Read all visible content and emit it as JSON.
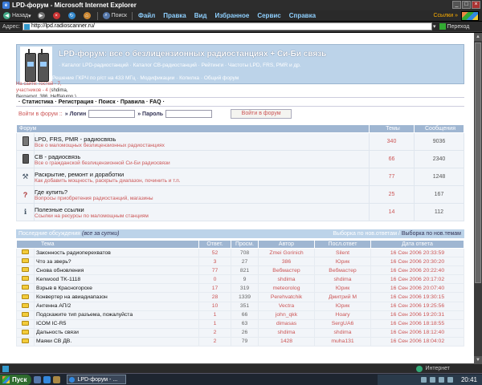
{
  "window": {
    "title": "LPD-форум - Microsoft Internet Explorer"
  },
  "toolbar": {
    "back_label": "Назад",
    "search_label": "Поиск",
    "menu": [
      "Файл",
      "Правка",
      "Вид",
      "Избранное",
      "Сервис",
      "Справка"
    ],
    "links_label": "Ссылки"
  },
  "address": {
    "label": "Адрес:",
    "url": "http://lpd.radioscanner.ru/",
    "go_label": "Переход"
  },
  "site": {
    "title": "LPD-форум: все о безлицензионных радиостанциях + Си-Би связь",
    "nav1": "· Каталог LPD-радиостанций · Каталог СВ-радиостанций · Рейтинги · Частоты LPD, FRS, PMR и др.",
    "nav2": "· Решение ГКРЧ по р/ст на 433 МГц · Модификации · Копилка · Общий форум",
    "guests_line1": "На сайте: гостей - 7,",
    "guests_line2": "участников - 4 (",
    "guests_names": "shdima, Bergamot, 386, Hefflalump )",
    "mainmenu": "· Статистика · Регистрация · Поиск · Правила · FAQ ·"
  },
  "login": {
    "prefix": "Войти в форум ::",
    "login_label": "» Логин",
    "password_label": "» Пароль",
    "button": "Войти в форум"
  },
  "forums": {
    "headers": [
      "Форум",
      "Темы",
      "Сообщения"
    ],
    "rows": [
      {
        "icon": "radio-icon",
        "title": "LPD, FRS, PMR - радиосвязь",
        "desc": "Все о маломощных безлицензионных радиостанциях",
        "topics": "340",
        "posts": "9036"
      },
      {
        "icon": "radio-icon",
        "title": "СВ - радиосвязь",
        "desc": "Все о гражданской безлицензионной Си-Би радиосвязи",
        "topics": "66",
        "posts": "2340"
      },
      {
        "icon": "tool-icon",
        "title": "Раскрытие, ремонт и доработки",
        "desc": "Как добавить мощность, раскрыть диапазон, починить и т.п.",
        "topics": "77",
        "posts": "1248"
      },
      {
        "icon": "question-icon",
        "title": "Где купить?",
        "desc": "Вопросы приобретения радиостанций, магазины",
        "topics": "25",
        "posts": "167"
      },
      {
        "icon": "info-icon",
        "title": "Полезные ссылки",
        "desc": "Ссылки на ресурсы по маломощным станциям",
        "topics": "14",
        "posts": "112"
      }
    ]
  },
  "latest": {
    "title": "Последние обсуждения",
    "period": "(все за сутки)",
    "sort_prefix": "Выборка по нов.ответам /",
    "sort_selected": "Выборка по нов.темам",
    "headers": [
      "Тема",
      "Ответ.",
      "Просм.",
      "Автор",
      "Посл.ответ",
      "Дата ответа"
    ],
    "rows": [
      {
        "topic": "Законность радиоперехватов",
        "replies": "52",
        "views": "708",
        "author": "Zmei Gorinich",
        "last": "Silent",
        "date": "16 Сен 2006 20:33:59"
      },
      {
        "topic": "Что за зверь?",
        "replies": "3",
        "views": "27",
        "author": "386",
        "last": "Юрик",
        "date": "16 Сен 2006 20:30:20"
      },
      {
        "topic": "Снова обновления",
        "replies": "77",
        "views": "821",
        "author": "Вебмастер",
        "last": "Вебмастер",
        "date": "16 Сен 2006 20:22:40"
      },
      {
        "topic": "Kenwood TK-1118",
        "replies": "0",
        "views": "9",
        "author": "shdima",
        "last": "shdima",
        "date": "16 Сен 2006 20:17:02"
      },
      {
        "topic": "Взрыв в Красногорске",
        "replies": "17",
        "views": "319",
        "author": "meteorolog",
        "last": "Юрик",
        "date": "16 Сен 2006 20:07:40"
      },
      {
        "topic": "Конвертер на авиадиапазон",
        "replies": "28",
        "views": "1339",
        "author": "Perehvatchik",
        "last": "Дмитрий М",
        "date": "16 Сен 2006 19:30:15"
      },
      {
        "topic": "Антенна АП/2",
        "replies": "10",
        "views": "351",
        "author": "Vectra",
        "last": "Юрик",
        "date": "16 Сен 2006 19:25:56"
      },
      {
        "topic": "Подскажите тип разъема, пожалуйста",
        "replies": "1",
        "views": "66",
        "author": "john_qkk",
        "last": "Hoary",
        "date": "16 Сен 2006 19:20:31"
      },
      {
        "topic": "ICOM IC-R5",
        "replies": "1",
        "views": "63",
        "author": "dimasas",
        "last": "SergUA6",
        "date": "16 Сен 2006 18:18:55"
      },
      {
        "topic": "Дальность связи",
        "replies": "2",
        "views": "26",
        "author": "shdima",
        "last": "shdima",
        "date": "16 Сен 2006 18:12:40"
      },
      {
        "topic": "Маяки СВ ДВ.",
        "replies": "2",
        "views": "79",
        "author": "1428",
        "last": "muha131",
        "date": "16 Сен 2006 18:04:02"
      }
    ]
  },
  "status": {
    "zone": "Интернет"
  },
  "taskbar": {
    "start_label": "Пуск",
    "task_label": "LPD-форум - ...",
    "clock": "20:41"
  }
}
